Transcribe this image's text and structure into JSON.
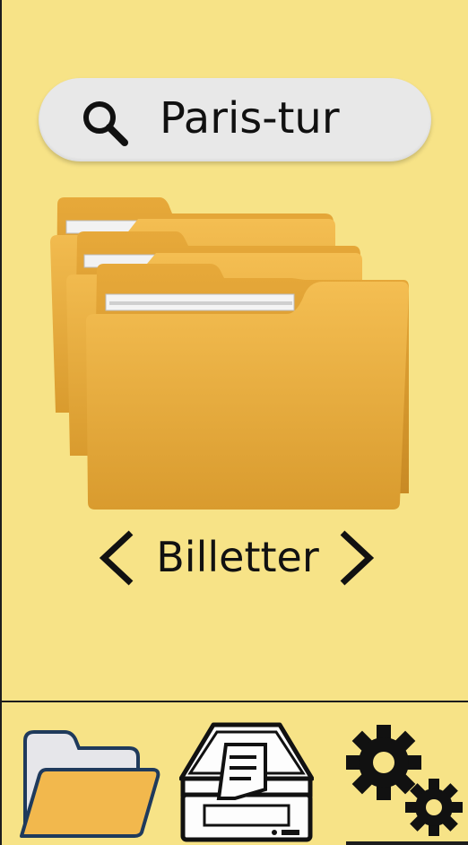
{
  "search": {
    "value": "Paris-tur",
    "icon": "search-icon"
  },
  "carousel": {
    "label": "Billetter",
    "prev_icon": "chevron-left-icon",
    "next_icon": "chevron-right-icon"
  },
  "nav": {
    "items": [
      {
        "icon": "folder-icon",
        "active": false
      },
      {
        "icon": "scanner-icon",
        "active": false
      },
      {
        "icon": "gears-icon",
        "active": true
      }
    ]
  },
  "colors": {
    "background": "#f7e387",
    "folder": "#f0b545",
    "search_bar": "#e8e8e8",
    "ink": "#111111",
    "nav_folder_outline": "#1f3a5c"
  }
}
